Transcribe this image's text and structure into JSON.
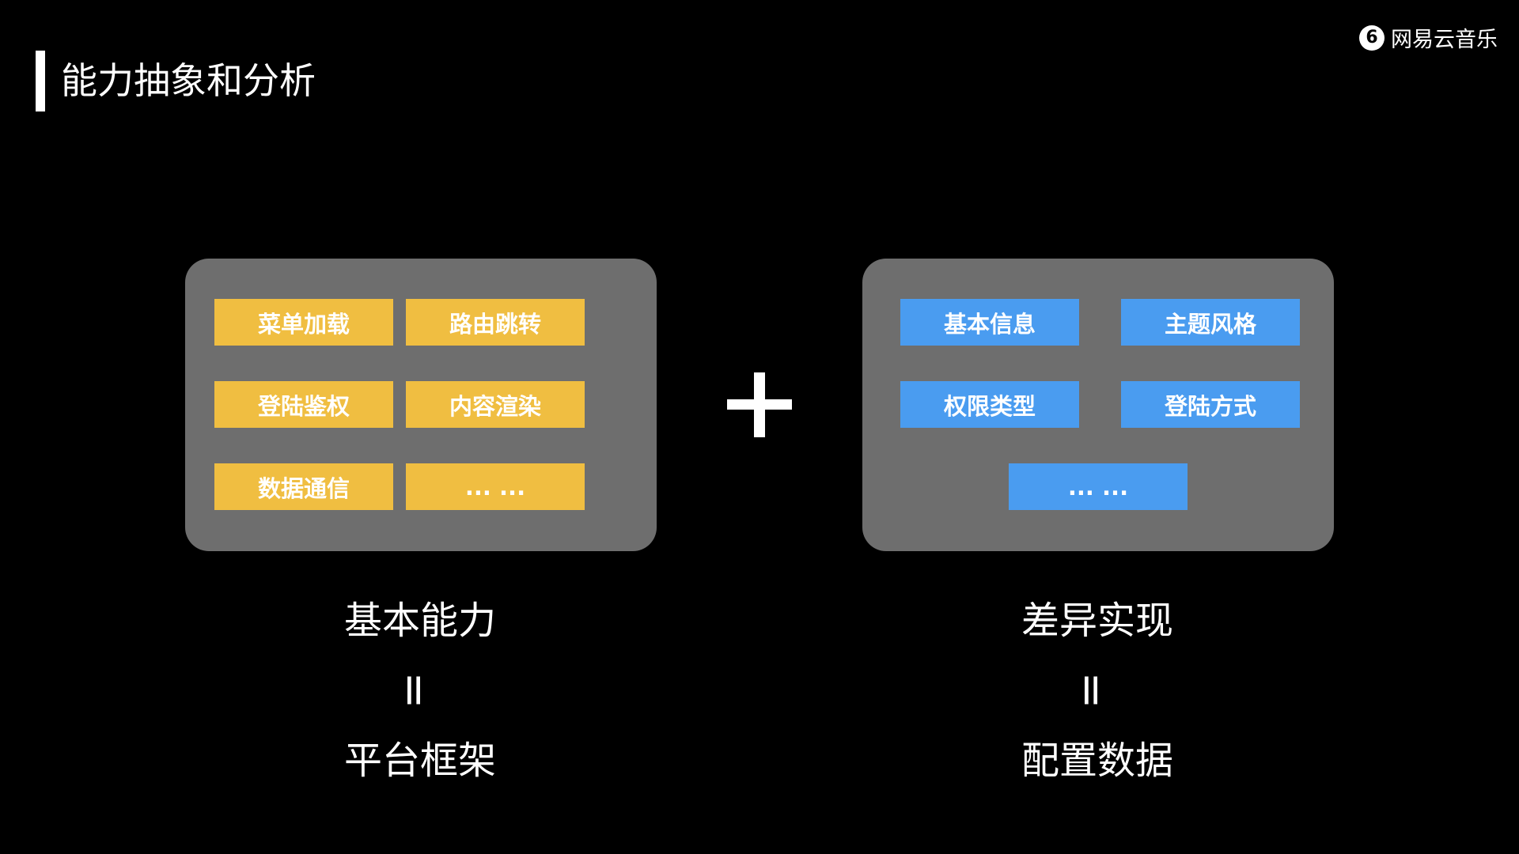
{
  "title": "能力抽象和分析",
  "brand": {
    "name": "网易云音乐",
    "icon": "netease-music-logo-icon"
  },
  "left_panel": {
    "items": [
      "菜单加载",
      "路由跳转",
      "登陆鉴权",
      "内容渲染",
      "数据通信",
      "... ..."
    ],
    "color": "#f0be41"
  },
  "right_panel": {
    "items": [
      "基本信息",
      "主题风格",
      "权限类型",
      "登陆方式",
      "... ..."
    ],
    "color": "#4a9cf0"
  },
  "operator": "+",
  "left_caption": {
    "top": "基本能力",
    "equals": "=",
    "bottom": "平台框架"
  },
  "right_caption": {
    "top": "差异实现",
    "equals": "=",
    "bottom": "配置数据"
  }
}
